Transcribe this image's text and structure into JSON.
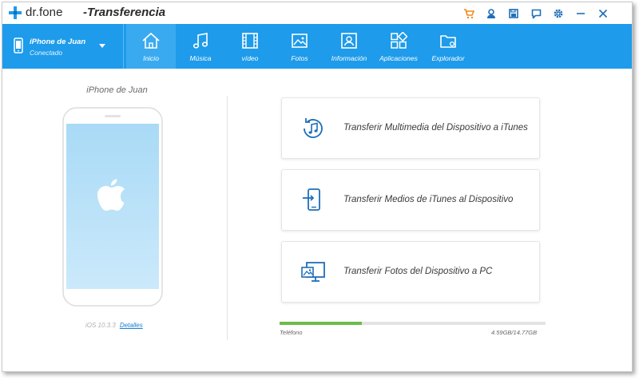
{
  "app": {
    "name": "dr.fone",
    "subtitle": "-Transferencia",
    "accent": "#1e9bea",
    "title_icons": [
      "cart-icon",
      "user-icon",
      "save-icon",
      "feedback-icon",
      "settings-icon",
      "minimize-icon",
      "close-icon"
    ]
  },
  "device": {
    "name": "iPhone de Juan",
    "status": "Conectado"
  },
  "tabs": [
    {
      "label": "Inicio",
      "icon": "home-icon",
      "active": true
    },
    {
      "label": "Música",
      "icon": "music-icon",
      "active": false
    },
    {
      "label": "vídeo",
      "icon": "video-icon",
      "active": false
    },
    {
      "label": "Fotos",
      "icon": "photo-icon",
      "active": false
    },
    {
      "label": "Información",
      "icon": "contact-icon",
      "active": false
    },
    {
      "label": "Aplicaciones",
      "icon": "apps-icon",
      "active": false
    },
    {
      "label": "Explorador",
      "icon": "folder-icon",
      "active": false
    }
  ],
  "left": {
    "device_title": "iPhone de Juan",
    "ios_version": "iOS 10.3.3",
    "details_link": "Detalles"
  },
  "cards": [
    {
      "label": "Transferir Multimedia del Dispositivo a iTunes",
      "icon": "itunes-sync-icon"
    },
    {
      "label": "Transferir Medios de iTunes al Dispositivo",
      "icon": "device-transfer-icon"
    },
    {
      "label": "Transferir Fotos del Dispositivo a PC",
      "icon": "photo-to-pc-icon"
    }
  ],
  "storage": {
    "label": "Teléfono",
    "value": "4.59GB/14.77GB",
    "used_fraction": 0.31,
    "fill_color": "#6dbc4a"
  }
}
